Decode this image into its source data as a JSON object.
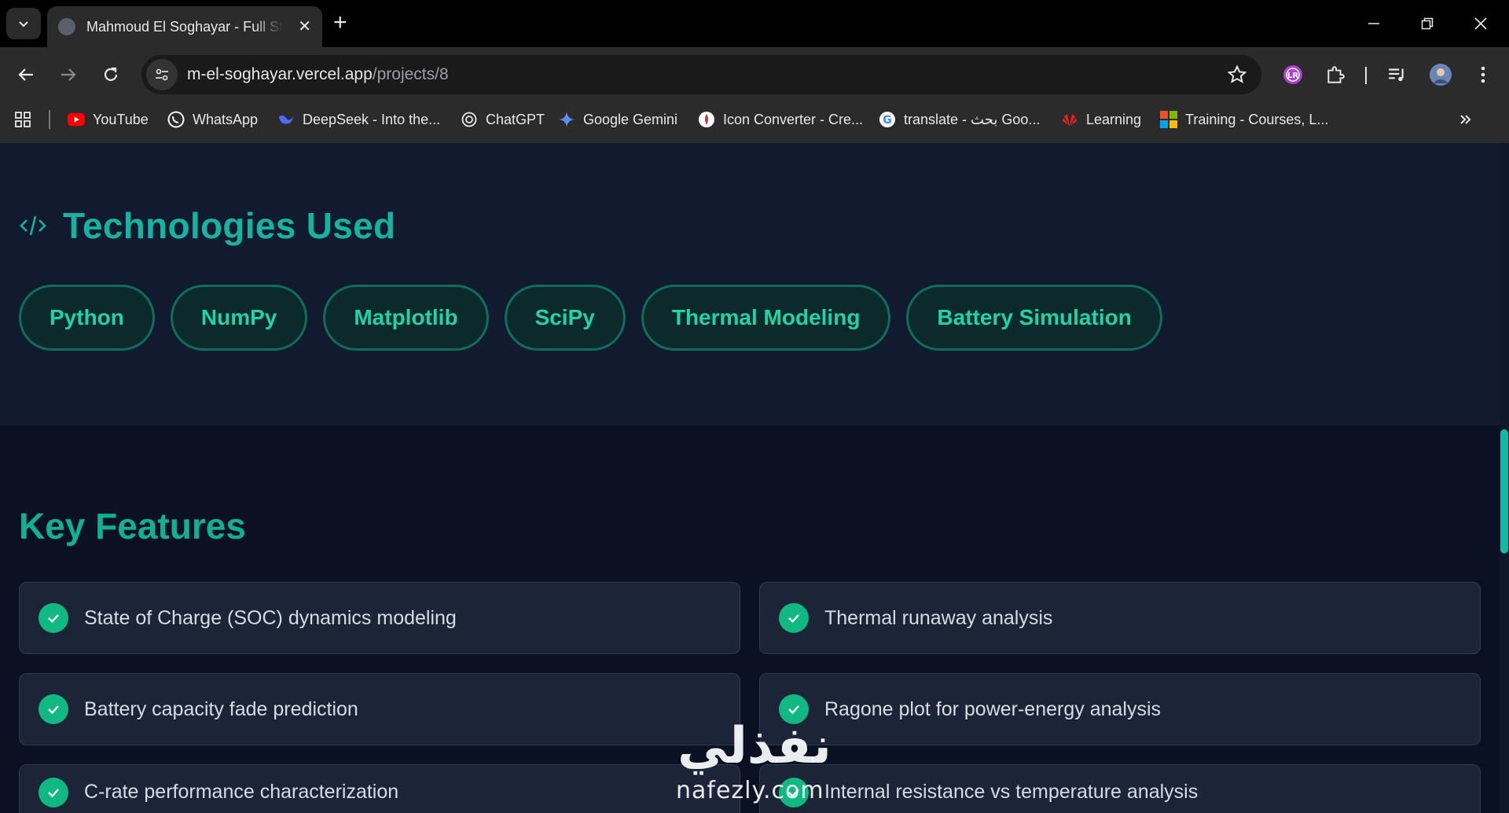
{
  "browser": {
    "tab_title": "Mahmoud El Soghayar - Full Stack",
    "url_host": "m-el-soghayar.vercel.app",
    "url_path": "/projects/8",
    "bookmarks": [
      {
        "label": "YouTube",
        "icon": "youtube-icon"
      },
      {
        "label": "WhatsApp",
        "icon": "whatsapp-icon"
      },
      {
        "label": "DeepSeek - Into the...",
        "icon": "deepseek-icon"
      },
      {
        "label": "ChatGPT",
        "icon": "chatgpt-icon"
      },
      {
        "label": "Google Gemini",
        "icon": "gemini-icon"
      },
      {
        "label": "Icon Converter - Cre...",
        "icon": "icon-converter-icon"
      },
      {
        "label": "translate - بحث Goo...",
        "icon": "google-icon"
      },
      {
        "label": "Learning",
        "icon": "huawei-icon"
      },
      {
        "label": "Training - Courses, L...",
        "icon": "microsoft-icon"
      }
    ]
  },
  "technologies": {
    "heading": "Technologies Used",
    "items": [
      "Python",
      "NumPy",
      "Matplotlib",
      "SciPy",
      "Thermal Modeling",
      "Battery Simulation"
    ]
  },
  "features": {
    "heading": "Key Features",
    "items": [
      "State of Charge (SOC) dynamics modeling",
      "Thermal runaway analysis",
      "Battery capacity fade prediction",
      "Ragone plot for power-energy analysis",
      "C-rate performance characterization",
      "Internal resistance vs temperature analysis"
    ]
  },
  "watermark": {
    "arabic": "نفذلي",
    "latin": "nafezly.com"
  },
  "colors": {
    "accent_teal": "#15b3a0",
    "chip_text": "#22d3a5",
    "check_green": "#10b981",
    "page_bg": "#111a2e"
  }
}
